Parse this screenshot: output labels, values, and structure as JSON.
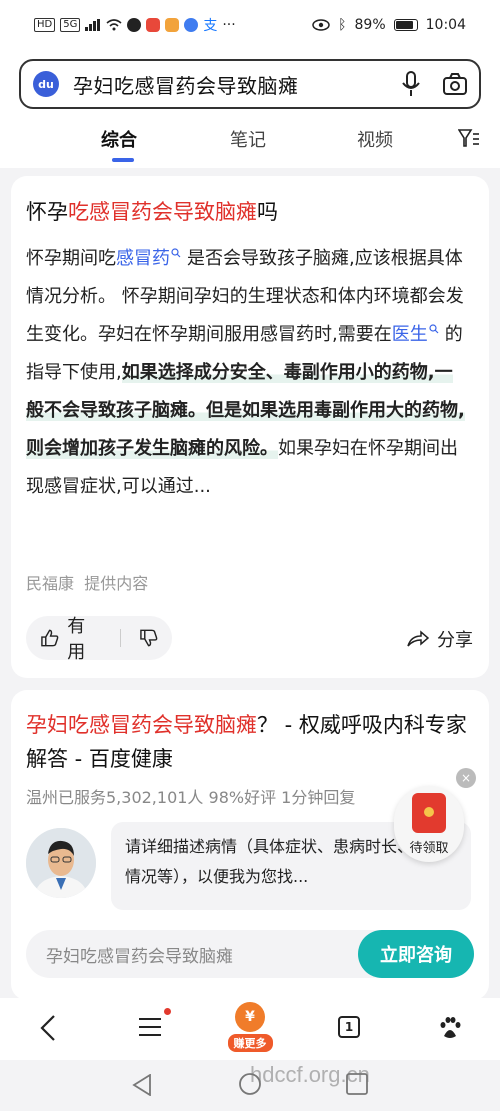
{
  "status": {
    "left_badges": [
      "HD",
      "5G"
    ],
    "battery": "89%",
    "time": "10:04"
  },
  "search": {
    "query": "孕妇吃感冒药会导致脑瘫",
    "logo_text": "du"
  },
  "tabs": [
    {
      "label": "综合",
      "active": true
    },
    {
      "label": "笔记",
      "active": false
    },
    {
      "label": "视频",
      "active": false
    }
  ],
  "result1": {
    "title_prefix": "怀孕",
    "title_highlight": "吃感冒药会导致脑瘫",
    "title_suffix": "吗",
    "body": {
      "p1": "怀孕期间吃",
      "link1": "感冒药",
      "p2": "是否会导致孩子脑瘫,应该根据具体情况分析。 怀孕期间孕妇的生理状态和体内环境都会发生变化。孕妇在怀孕期间服用感冒药时,需要在",
      "link2": "医生",
      "p3": "的指导下使用,",
      "bold": "如果选择成分安全、毒副作用小的药物,一般不会导致孩子脑瘫。但是如果选用毒副作用大的药物,则会增加孩子发生脑瘫的风险。",
      "p4": "如果孕妇在怀孕期间出现感冒症状,可以通过..."
    },
    "source": "民福康",
    "source_note": "提供内容",
    "useful_label": "有用",
    "share_label": "分享"
  },
  "result2": {
    "title_highlight": "孕妇吃感冒药会导致脑瘫",
    "title_rest": "？ - 权威呼吸内科专家解答 - 百度健康",
    "meta": "温州已服务5,302,101人  98%好评  1分钟回复",
    "bubble": "请详细描述病情（具体症状、患病时长、用药情况等），以便我为您找...",
    "consult_placeholder": "孕妇吃感冒药会导致脑瘫",
    "consult_button": "立即咨询"
  },
  "redpack": {
    "label": "待领取",
    "close": "×"
  },
  "bottomnav": {
    "earn_coin": "¥",
    "earn_label": "赚更多",
    "tabs_count": "1"
  },
  "watermark": "hdccf.org.cn"
}
